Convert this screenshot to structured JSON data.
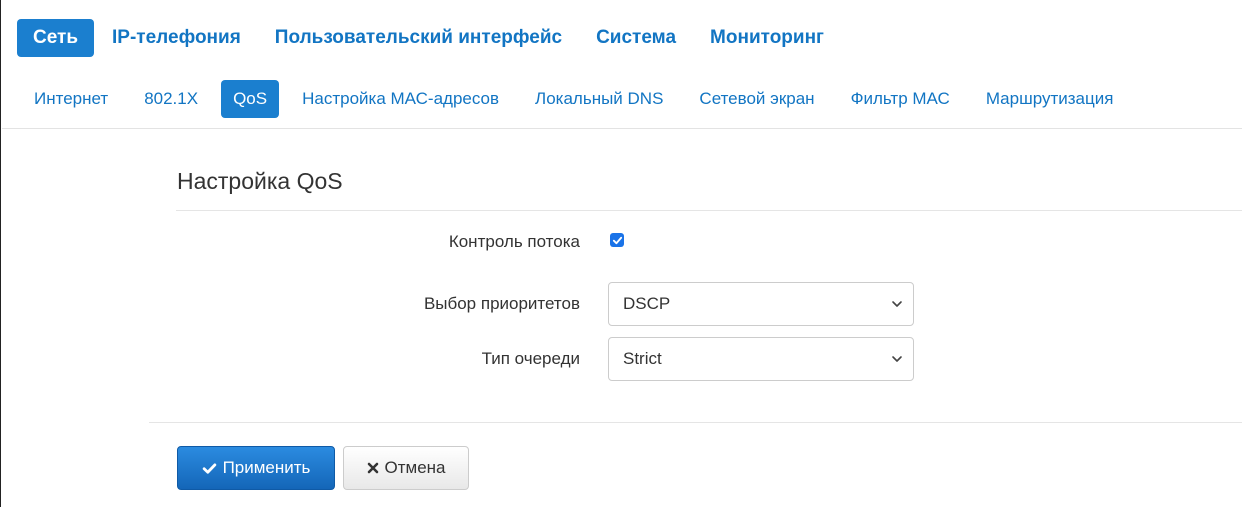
{
  "top_nav": {
    "items": [
      {
        "label": "Сеть",
        "active": true
      },
      {
        "label": "IP-телефония",
        "active": false
      },
      {
        "label": "Пользовательский интерфейс",
        "active": false
      },
      {
        "label": "Система",
        "active": false
      },
      {
        "label": "Мониторинг",
        "active": false
      }
    ]
  },
  "sub_nav": {
    "items": [
      {
        "label": "Интернет",
        "active": false
      },
      {
        "label": "802.1X",
        "active": false
      },
      {
        "label": "QoS",
        "active": true
      },
      {
        "label": "Настройка МАС-адресов",
        "active": false
      },
      {
        "label": "Локальный DNS",
        "active": false
      },
      {
        "label": "Сетевой экран",
        "active": false
      },
      {
        "label": "Фильтр МАС",
        "active": false
      },
      {
        "label": "Маршрутизация",
        "active": false
      }
    ]
  },
  "panel": {
    "title": "Настройка QoS",
    "flow_control": {
      "label": "Контроль потока",
      "checked": true
    },
    "priority_select": {
      "label": "Выбор приоритетов",
      "value": "DSCP"
    },
    "queue_type": {
      "label": "Тип очереди",
      "value": "Strict"
    }
  },
  "actions": {
    "apply_label": "Применить",
    "cancel_label": "Отмена"
  },
  "colors": {
    "accent": "#1b7fcf",
    "link": "#1275c3",
    "checkbox": "#1a73e8"
  },
  "icons": {
    "apply": "check-icon",
    "cancel": "close-icon",
    "select": "chevron-down-icon"
  }
}
